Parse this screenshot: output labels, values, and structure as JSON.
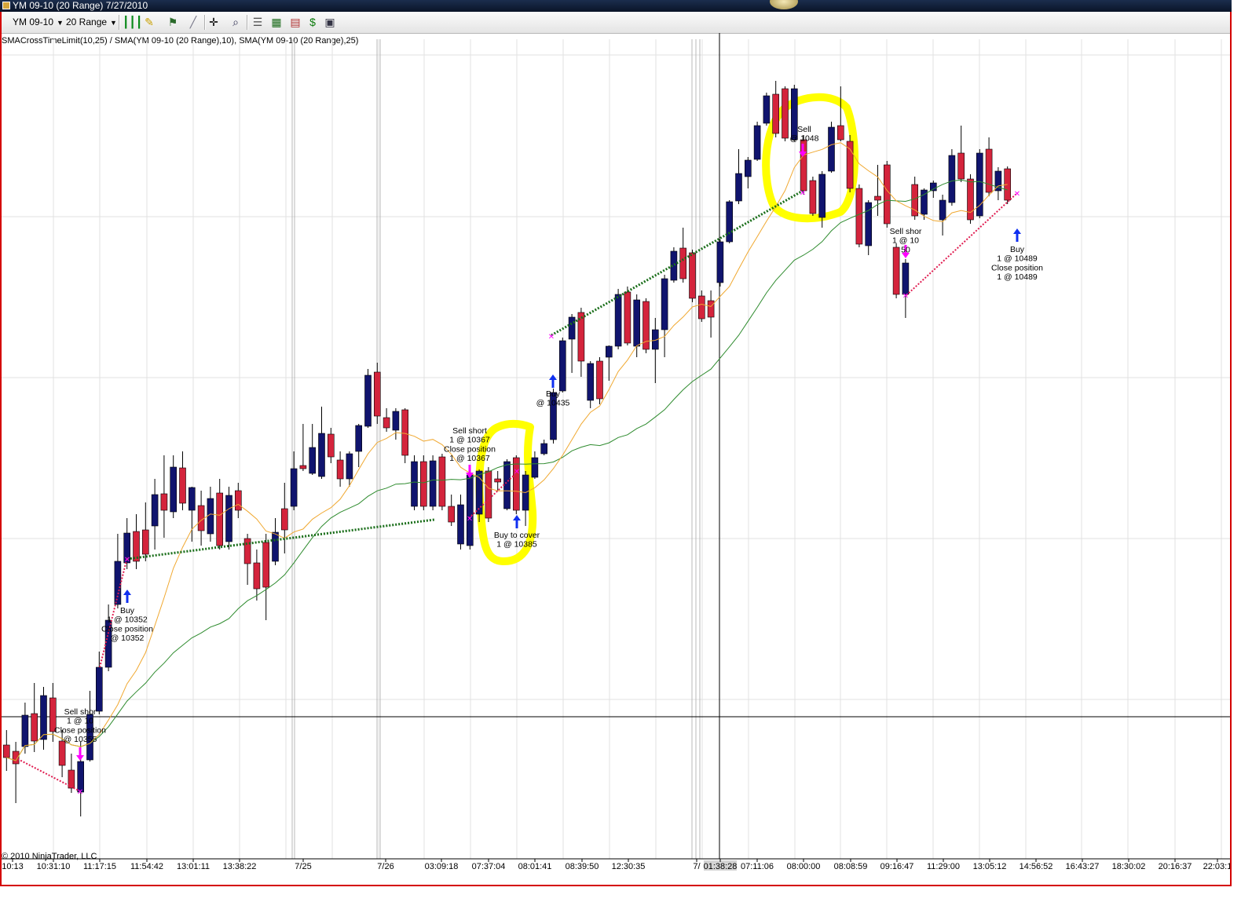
{
  "window": {
    "title": "YM 09-10 (20 Range)  7/27/2010"
  },
  "toolbar": {
    "instrument": "YM 09-10",
    "period": "20 Range",
    "icons": [
      "bar-style-icon",
      "drawing-pencil-icon",
      "trade-marker-icon",
      "draw-line-icon",
      "crosshair-icon",
      "zoom-icon",
      "data-box-icon",
      "chart-trader-icon",
      "strategy-dollar-icon",
      "properties-icon"
    ]
  },
  "chart_label": "SMACrossTimeLimit(10,25) / SMA(YM 09-10 (20 Range),10), SMA(YM 09-10 (20 Range),25)",
  "copyright": "© 2010 NinjaTrader, LLC",
  "colors": {
    "up_candle": "#10146e",
    "down_candle": "#d4243c",
    "sma_fast": "#f0a830",
    "sma_slow": "#2e8b2e",
    "long_trade_line": "#1a6e1a",
    "short_trade_line": "#e01c50",
    "buy_arrow": "#1030f0",
    "sell_arrow": "#ff00ff",
    "highlight": "#ffff00"
  },
  "x_axis_labels": [
    "10:13",
    "10:31:10",
    "11:17:15",
    "11:54:42",
    "13:01:11",
    "13:38:22",
    "7/25",
    "7/26",
    "03:09:18",
    "07:37:04",
    "08:01:41",
    "08:39:50",
    "12:30:35",
    "7/",
    "01:38:28",
    "07:11:06",
    "08:00:00",
    "08:08:59",
    "09:16:47",
    "11:29:00",
    "13:05:12",
    "14:56:52",
    "16:43:27",
    "18:30:02",
    "20:16:37",
    "22:03:1"
  ],
  "annotations": {
    "a1": [
      "Sell shor",
      "1 @ 10",
      "Close position",
      "@ 10355"
    ],
    "a2": [
      "Buy",
      "1 @ 10352",
      "Close position",
      "@ 10352"
    ],
    "a3": [
      "Sell short",
      "1 @ 10367",
      "Close position",
      "1 @ 10367"
    ],
    "a4": [
      "Buy to cover",
      "1 @ 10385"
    ],
    "a5": [
      "Buy",
      "@ 10435"
    ],
    "a6": [
      "Sell",
      "@ 1048"
    ],
    "a7": [
      "Sell shor",
      "1 @ 10",
      "50"
    ],
    "a8": [
      "Buy",
      "1 @ 10489",
      "Close position",
      "1 @ 10489"
    ]
  },
  "chart_data": {
    "type": "candlestick",
    "title": "",
    "series": [
      {
        "name": "SMA(YM 09-10 (20 Range),10)"
      },
      {
        "name": "SMA(YM 09-10 (20 Range),25)"
      }
    ],
    "candles": [
      {
        "d": "d",
        "o": 949,
        "c": 965,
        "h": 930,
        "l": 982
      },
      {
        "d": "d",
        "o": 957,
        "c": 973,
        "h": 945,
        "l": 1023
      },
      {
        "d": "u",
        "o": 951,
        "c": 911,
        "h": 895,
        "l": 960
      },
      {
        "d": "d",
        "o": 909,
        "c": 944,
        "h": 870,
        "l": 958
      },
      {
        "d": "u",
        "o": 942,
        "c": 886,
        "h": 875,
        "l": 955
      },
      {
        "d": "d",
        "o": 889,
        "c": 932,
        "h": 870,
        "l": 945
      },
      {
        "d": "d",
        "o": 944,
        "c": 975,
        "h": 930,
        "l": 990
      },
      {
        "d": "d",
        "o": 981,
        "c": 1004,
        "h": 960,
        "l": 1010
      },
      {
        "d": "u",
        "o": 1009,
        "c": 970,
        "h": 945,
        "l": 1040
      },
      {
        "d": "u",
        "o": 968,
        "c": 910,
        "h": 880,
        "l": 970
      },
      {
        "d": "u",
        "o": 906,
        "c": 850,
        "h": 830,
        "l": 910
      },
      {
        "d": "u",
        "o": 850,
        "c": 790,
        "h": 770,
        "l": 855
      },
      {
        "d": "u",
        "o": 770,
        "c": 715,
        "h": 680,
        "l": 775
      },
      {
        "d": "u",
        "o": 717,
        "c": 679,
        "h": 660,
        "l": 725
      },
      {
        "d": "d",
        "o": 677,
        "c": 715,
        "h": 655,
        "l": 725
      },
      {
        "d": "d",
        "o": 675,
        "c": 706,
        "h": 640,
        "l": 715
      },
      {
        "d": "u",
        "o": 670,
        "c": 630,
        "h": 610,
        "l": 700
      },
      {
        "d": "d",
        "o": 629,
        "c": 650,
        "h": 580,
        "l": 685
      },
      {
        "d": "u",
        "o": 652,
        "c": 595,
        "h": 580,
        "l": 660
      },
      {
        "d": "d",
        "o": 596,
        "c": 641,
        "h": 575,
        "l": 650
      },
      {
        "d": "u",
        "o": 650,
        "c": 621,
        "h": 620,
        "l": 690
      },
      {
        "d": "d",
        "o": 644,
        "c": 676,
        "h": 625,
        "l": 695
      },
      {
        "d": "u",
        "o": 680,
        "c": 635,
        "h": 620,
        "l": 690
      },
      {
        "d": "d",
        "o": 628,
        "c": 695,
        "h": 610,
        "l": 700
      },
      {
        "d": "u",
        "o": 690,
        "c": 631,
        "h": 620,
        "l": 700
      },
      {
        "d": "d",
        "o": 625,
        "c": 650,
        "h": 615,
        "l": 660
      },
      {
        "d": "d",
        "o": 686,
        "c": 718,
        "h": 680,
        "l": 745
      },
      {
        "d": "d",
        "o": 717,
        "c": 750,
        "h": 700,
        "l": 765
      },
      {
        "d": "d",
        "o": 691,
        "c": 748,
        "h": 680,
        "l": 790
      },
      {
        "d": "u",
        "o": 715,
        "c": 678,
        "h": 660,
        "l": 720
      },
      {
        "d": "d",
        "o": 648,
        "c": 675,
        "h": 615,
        "l": 705
      },
      {
        "d": "u",
        "o": 645,
        "c": 597,
        "h": 575,
        "l": 650
      },
      {
        "d": "d",
        "o": 593,
        "c": 597,
        "h": 540,
        "l": 600
      },
      {
        "d": "u",
        "o": 603,
        "c": 570,
        "h": 540,
        "l": 605
      },
      {
        "d": "u",
        "o": 607,
        "c": 552,
        "h": 518,
        "l": 610
      },
      {
        "d": "d",
        "o": 553,
        "c": 582,
        "h": 545,
        "l": 590
      },
      {
        "d": "d",
        "o": 586,
        "c": 610,
        "h": 575,
        "l": 620
      },
      {
        "d": "u",
        "o": 610,
        "c": 578,
        "h": 575,
        "l": 620
      },
      {
        "d": "u",
        "o": 575,
        "c": 542,
        "h": 540,
        "l": 595
      },
      {
        "d": "u",
        "o": 543,
        "c": 478,
        "h": 470,
        "l": 545
      },
      {
        "d": "d",
        "o": 474,
        "c": 530,
        "h": 462,
        "l": 540
      },
      {
        "d": "d",
        "o": 532,
        "c": 545,
        "h": 520,
        "l": 550
      },
      {
        "d": "u",
        "o": 548,
        "c": 524,
        "h": 520,
        "l": 560
      },
      {
        "d": "d",
        "o": 522,
        "c": 580,
        "h": 520,
        "l": 590
      },
      {
        "d": "u",
        "o": 645,
        "c": 588,
        "h": 580,
        "l": 650
      },
      {
        "d": "d",
        "o": 588,
        "c": 645,
        "h": 580,
        "l": 650
      },
      {
        "d": "u",
        "o": 645,
        "c": 587,
        "h": 580,
        "l": 650
      },
      {
        "d": "d",
        "o": 582,
        "c": 645,
        "h": 578,
        "l": 650
      },
      {
        "d": "d",
        "o": 645,
        "c": 665,
        "h": 630,
        "l": 670
      },
      {
        "d": "u",
        "o": 693,
        "c": 643,
        "h": 630,
        "l": 700
      },
      {
        "d": "u",
        "o": 695,
        "c": 605,
        "h": 600,
        "l": 700
      },
      {
        "d": "u",
        "o": 655,
        "c": 600,
        "h": 598,
        "l": 665
      },
      {
        "d": "d",
        "o": 600,
        "c": 660,
        "h": 595,
        "l": 665
      },
      {
        "d": "d",
        "o": 610,
        "c": 614,
        "h": 600,
        "l": 625
      },
      {
        "d": "u",
        "o": 648,
        "c": 588,
        "h": 585,
        "l": 650
      },
      {
        "d": "d",
        "o": 583,
        "c": 650,
        "h": 580,
        "l": 655
      },
      {
        "d": "u",
        "o": 650,
        "c": 605,
        "h": 600,
        "l": 670
      },
      {
        "d": "u",
        "o": 608,
        "c": 583,
        "h": 575,
        "l": 610
      },
      {
        "d": "u",
        "o": 578,
        "c": 565,
        "h": 560,
        "l": 580
      },
      {
        "d": "u",
        "o": 560,
        "c": 500,
        "h": 495,
        "l": 565
      },
      {
        "d": "u",
        "o": 498,
        "c": 434,
        "h": 430,
        "l": 500
      },
      {
        "d": "u",
        "o": 432,
        "c": 404,
        "h": 400,
        "l": 475
      },
      {
        "d": "d",
        "o": 398,
        "c": 460,
        "h": 392,
        "l": 480
      },
      {
        "d": "u",
        "o": 510,
        "c": 463,
        "h": 460,
        "l": 520
      },
      {
        "d": "d",
        "o": 460,
        "c": 508,
        "h": 455,
        "l": 515
      },
      {
        "d": "u",
        "o": 455,
        "c": 441,
        "h": 440,
        "l": 485
      },
      {
        "d": "u",
        "o": 441,
        "c": 375,
        "h": 368,
        "l": 445
      },
      {
        "d": "d",
        "o": 372,
        "c": 437,
        "h": 365,
        "l": 440
      },
      {
        "d": "u",
        "o": 441,
        "c": 382,
        "h": 375,
        "l": 455
      },
      {
        "d": "d",
        "o": 384,
        "c": 445,
        "h": 380,
        "l": 450
      },
      {
        "d": "u",
        "o": 445,
        "c": 420,
        "h": 405,
        "l": 488
      },
      {
        "d": "u",
        "o": 420,
        "c": 355,
        "h": 350,
        "l": 455
      },
      {
        "d": "u",
        "o": 357,
        "c": 320,
        "h": 315,
        "l": 360
      },
      {
        "d": "d",
        "o": 316,
        "c": 355,
        "h": 290,
        "l": 360
      },
      {
        "d": "d",
        "o": 322,
        "c": 380,
        "h": 318,
        "l": 385
      },
      {
        "d": "d",
        "o": 377,
        "c": 406,
        "h": 370,
        "l": 410
      },
      {
        "d": "d",
        "o": 383,
        "c": 404,
        "h": 370,
        "l": 430
      },
      {
        "d": "u",
        "o": 360,
        "c": 308,
        "h": 305,
        "l": 365
      },
      {
        "d": "u",
        "o": 308,
        "c": 257,
        "h": 255,
        "l": 310
      },
      {
        "d": "u",
        "o": 256,
        "c": 221,
        "h": 190,
        "l": 260
      },
      {
        "d": "u",
        "o": 225,
        "c": 204,
        "h": 200,
        "l": 240
      },
      {
        "d": "u",
        "o": 203,
        "c": 160,
        "h": 155,
        "l": 205
      },
      {
        "d": "u",
        "o": 157,
        "c": 122,
        "h": 118,
        "l": 160
      },
      {
        "d": "d",
        "o": 120,
        "c": 170,
        "h": 103,
        "l": 175
      },
      {
        "d": "d",
        "o": 113,
        "c": 176,
        "h": 110,
        "l": 180
      },
      {
        "d": "u",
        "o": 178,
        "c": 113,
        "h": 108,
        "l": 180
      },
      {
        "d": "d",
        "o": 178,
        "c": 243,
        "h": 172,
        "l": 248
      },
      {
        "d": "d",
        "o": 230,
        "c": 272,
        "h": 225,
        "l": 275
      },
      {
        "d": "u",
        "o": 277,
        "c": 222,
        "h": 218,
        "l": 290
      },
      {
        "d": "u",
        "o": 218,
        "c": 162,
        "h": 155,
        "l": 220
      },
      {
        "d": "d",
        "o": 160,
        "c": 178,
        "h": 110,
        "l": 180
      },
      {
        "d": "d",
        "o": 180,
        "c": 240,
        "h": 172,
        "l": 245
      },
      {
        "d": "d",
        "o": 240,
        "c": 311,
        "h": 235,
        "l": 315
      },
      {
        "d": "u",
        "o": 313,
        "c": 258,
        "h": 255,
        "l": 325
      },
      {
        "d": "d",
        "o": 250,
        "c": 255,
        "h": 210,
        "l": 275
      },
      {
        "d": "d",
        "o": 210,
        "c": 285,
        "h": 205,
        "l": 290
      },
      {
        "d": "d",
        "o": 315,
        "c": 375,
        "h": 310,
        "l": 380
      },
      {
        "d": "u",
        "o": 375,
        "c": 335,
        "h": 330,
        "l": 405
      },
      {
        "d": "d",
        "o": 235,
        "c": 275,
        "h": 225,
        "l": 280
      },
      {
        "d": "u",
        "o": 273,
        "c": 242,
        "h": 240,
        "l": 280
      },
      {
        "d": "u",
        "o": 243,
        "c": 233,
        "h": 230,
        "l": 252
      },
      {
        "d": "u",
        "o": 280,
        "c": 255,
        "h": 248,
        "l": 300
      },
      {
        "d": "u",
        "o": 258,
        "c": 198,
        "h": 190,
        "l": 262
      },
      {
        "d": "d",
        "o": 195,
        "c": 228,
        "h": 160,
        "l": 232
      },
      {
        "d": "d",
        "o": 228,
        "c": 280,
        "h": 222,
        "l": 285
      },
      {
        "d": "u",
        "o": 275,
        "c": 195,
        "h": 190,
        "l": 278
      },
      {
        "d": "d",
        "o": 190,
        "c": 245,
        "h": 175,
        "l": 250
      },
      {
        "d": "u",
        "o": 243,
        "c": 218,
        "h": 213,
        "l": 255
      },
      {
        "d": "d",
        "o": 215,
        "c": 255,
        "h": 212,
        "l": 260
      }
    ]
  }
}
